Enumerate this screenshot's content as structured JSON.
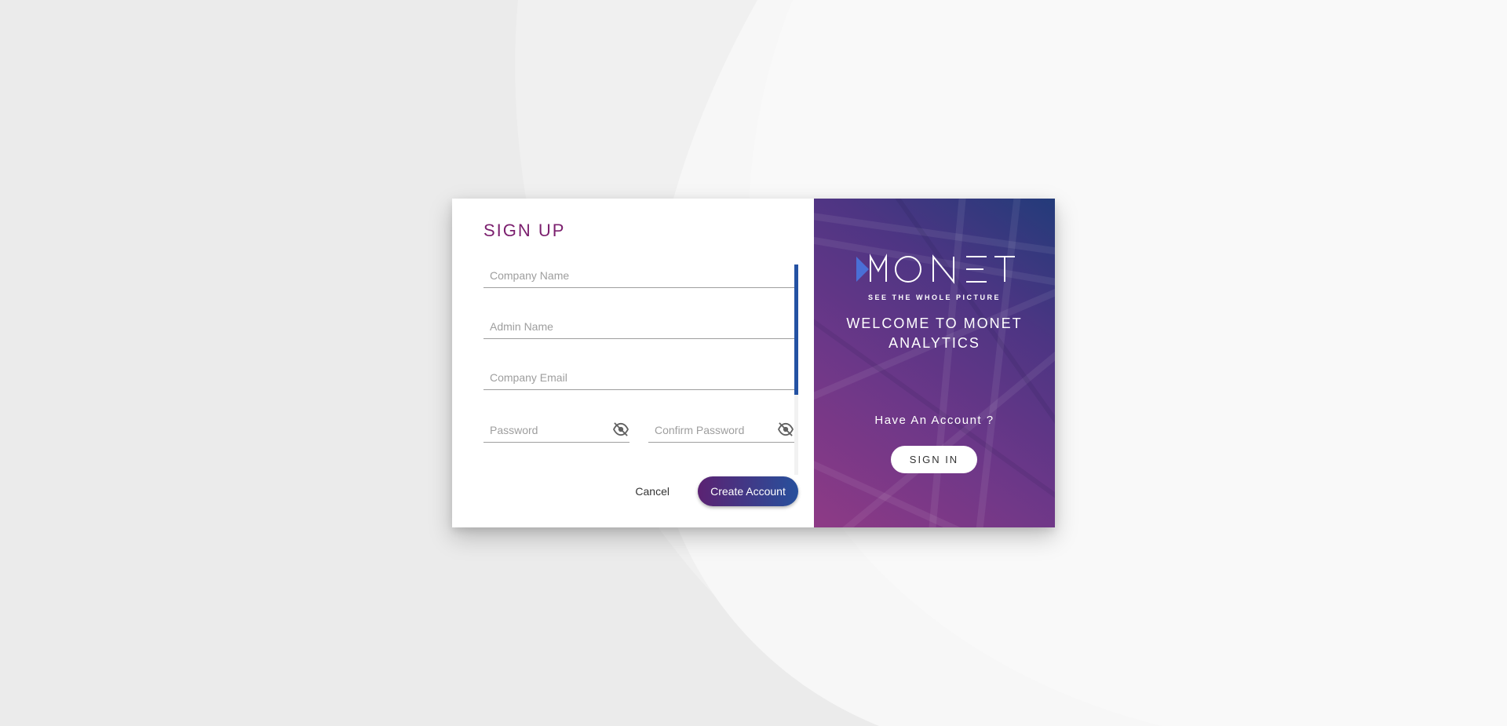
{
  "signup": {
    "title": "SIGN UP",
    "fields": {
      "company_name": {
        "value": "",
        "placeholder": "Company Name"
      },
      "admin_name": {
        "value": "",
        "placeholder": "Admin Name"
      },
      "company_email": {
        "value": "",
        "placeholder": "Company Email"
      },
      "password": {
        "value": "",
        "placeholder": "Password",
        "icon": "eye-off-icon"
      },
      "confirm_password": {
        "value": "",
        "placeholder": "Confirm Password",
        "icon": "eye-off-icon"
      }
    },
    "cancel_label": "Cancel",
    "create_label": "Create Account"
  },
  "brand": {
    "logo_text": "MONET",
    "tagline": "SEE THE WHOLE PICTURE",
    "welcome": "WELCOME TO MONET ANALYTICS",
    "have_account": "Have An Account ?",
    "signin_label": "SIGN IN"
  },
  "colors": {
    "title": "#7b1f6e",
    "accent_blue": "#2452a3",
    "gradient_start": "#5b2272",
    "gradient_end": "#27509c"
  }
}
